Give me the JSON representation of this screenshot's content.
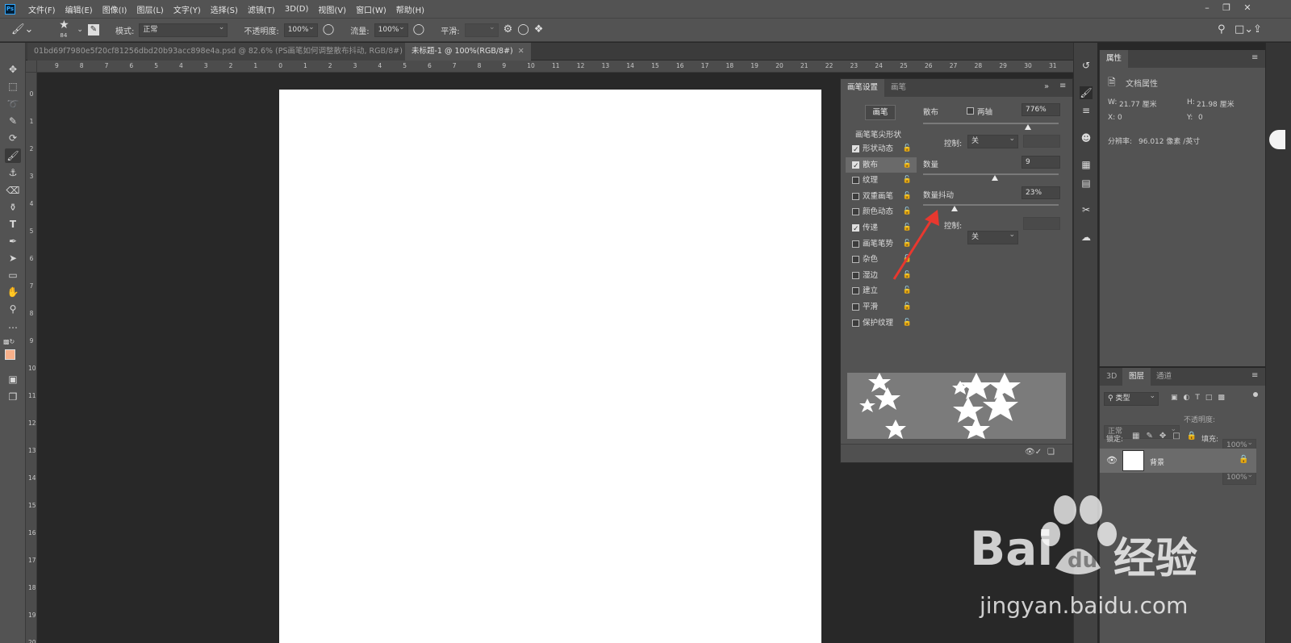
{
  "app": {
    "logo": "Ps"
  },
  "menu": [
    "文件(F)",
    "编辑(E)",
    "图像(I)",
    "图层(L)",
    "文字(Y)",
    "选择(S)",
    "滤镜(T)",
    "3D(D)",
    "视图(V)",
    "窗口(W)",
    "帮助(H)"
  ],
  "options": {
    "brush_size": "84",
    "mode_label": "模式:",
    "mode_value": "正常",
    "opacity_label": "不透明度:",
    "opacity_value": "100%",
    "flow_label": "流量:",
    "flow_value": "100%",
    "smooth_label": "平滑:"
  },
  "tabs": [
    {
      "label": "01bd69f7980e5f20cf81256dbd20b93acc898e4a.psd @ 82.6% (PS画笔如何调整散布抖动, RGB/8#) *",
      "active": false
    },
    {
      "label": "未标题-1 @ 100%(RGB/8#)",
      "active": true
    }
  ],
  "ruler": {
    "h": [
      "9",
      "8",
      "7",
      "6",
      "5",
      "4",
      "3",
      "2",
      "1",
      "0",
      "1",
      "2",
      "3",
      "4",
      "5",
      "6",
      "7",
      "8",
      "9",
      "10",
      "11",
      "12",
      "13",
      "14",
      "15",
      "16",
      "17",
      "18",
      "19",
      "20",
      "21",
      "22",
      "23",
      "24",
      "25",
      "26",
      "27",
      "28",
      "29",
      "30",
      "31"
    ],
    "v": [
      "0",
      "1",
      "2",
      "3",
      "4",
      "5",
      "6",
      "7",
      "8",
      "9",
      "10",
      "11",
      "12",
      "13",
      "14",
      "15",
      "16",
      "17",
      "18",
      "19",
      "20"
    ]
  },
  "brush_panel": {
    "tabs": [
      "画笔设置",
      "画笔"
    ],
    "brush_button": "画笔",
    "tip_shape": "画笔笔尖形状",
    "items": [
      {
        "label": "形状动态",
        "checked": true,
        "selected": false
      },
      {
        "label": "散布",
        "checked": true,
        "selected": true
      },
      {
        "label": "纹理",
        "checked": false,
        "selected": false
      },
      {
        "label": "双重画笔",
        "checked": false,
        "selected": false
      },
      {
        "label": "颜色动态",
        "checked": false,
        "selected": false
      },
      {
        "label": "传递",
        "checked": true,
        "selected": false
      },
      {
        "label": "画笔笔势",
        "checked": false,
        "selected": false
      },
      {
        "label": "杂色",
        "checked": false,
        "selected": false
      },
      {
        "label": "湿边",
        "checked": false,
        "selected": false
      },
      {
        "label": "建立",
        "checked": false,
        "selected": false
      },
      {
        "label": "平滑",
        "checked": false,
        "selected": false
      },
      {
        "label": "保护纹理",
        "checked": false,
        "selected": false
      }
    ],
    "scatter_label": "散布",
    "both_axes_label": "两轴",
    "scatter_value": "776%",
    "control_label": "控制:",
    "control_value": "关",
    "count_label": "数量",
    "count_value": "9",
    "count_jitter_label": "数量抖动",
    "count_jitter_value": "23%",
    "control2_label": "控制:",
    "control2_value": "关"
  },
  "properties": {
    "title": "属性",
    "doc_props": "文档属性",
    "w_label": "W:",
    "w_value": "21.77 厘米",
    "h_label": "H:",
    "h_value": "21.98 厘米",
    "x_label": "X:",
    "x_value": "0",
    "y_label": "Y:",
    "y_value": "0",
    "resolution_label": "分辨率:",
    "resolution_value": "96.012 像素 /英寸"
  },
  "layers": {
    "tabs": [
      "3D",
      "图层",
      "通道"
    ],
    "search_placeholder": "类型",
    "blend_mode": "正常",
    "opacity_label": "不透明度:",
    "opacity_value": "100%",
    "lock_label": "锁定:",
    "fill_label": "填充:",
    "fill_value": "100%",
    "layer_name": "背景"
  },
  "watermark": {
    "brand": "Bai",
    "du": "du",
    "cn": "经验",
    "url": "jingyan.baidu.com"
  },
  "colors": {
    "accent": "#31a8ff",
    "foreground_swatch": "#f7b08a",
    "arrow": "#e8382f"
  }
}
